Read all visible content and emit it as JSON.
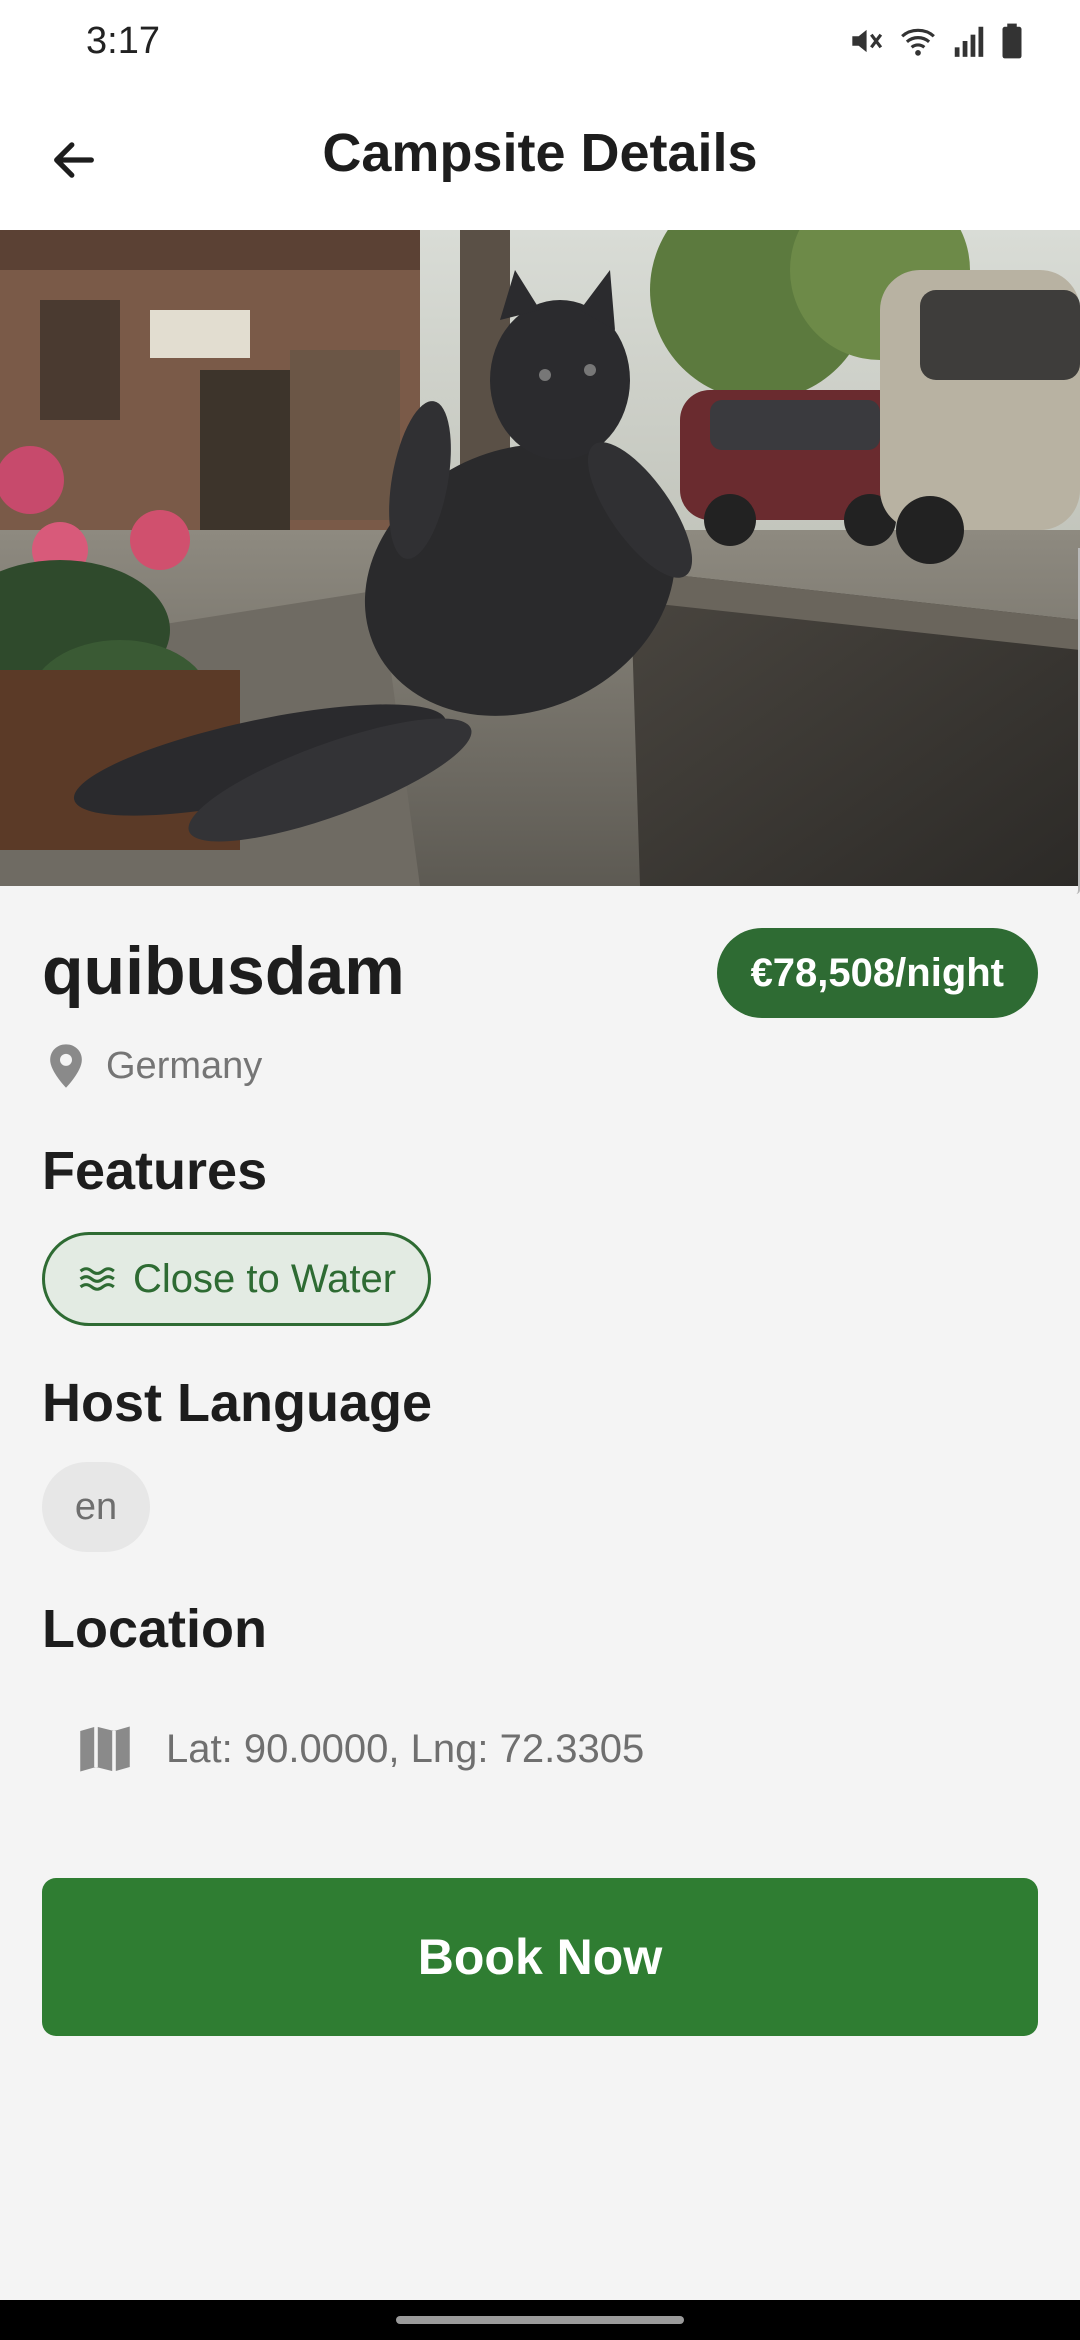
{
  "status_bar": {
    "time": "3:17",
    "icons": [
      "mute-icon",
      "wifi-icon",
      "signal-icon",
      "battery-icon"
    ]
  },
  "app_bar": {
    "title": "Campsite Details",
    "back_icon": "arrow-left-icon"
  },
  "hero": {
    "image_subject": "photo of a black cat statue reclining on a street curb"
  },
  "campsite": {
    "name": "quibusdam",
    "price": "€78,508/night",
    "location": "Germany",
    "location_icon": "map-pin-icon"
  },
  "features": {
    "title": "Features",
    "items": [
      {
        "label": "Close to Water",
        "icon": "waves-icon"
      }
    ]
  },
  "host_language": {
    "title": "Host Language",
    "items": [
      "en"
    ]
  },
  "location_section": {
    "title": "Location",
    "coordinates": "Lat: 90.0000, Lng: 72.3305",
    "icon": "map-icon"
  },
  "actions": {
    "book_label": "Book Now"
  },
  "colors": {
    "primary": "#2f7d32",
    "badge": "#2e6b33",
    "background": "#f4f4f4",
    "chip_feature_bg": "#e3ebe3",
    "chip_lang_bg": "#e7e7e7"
  }
}
